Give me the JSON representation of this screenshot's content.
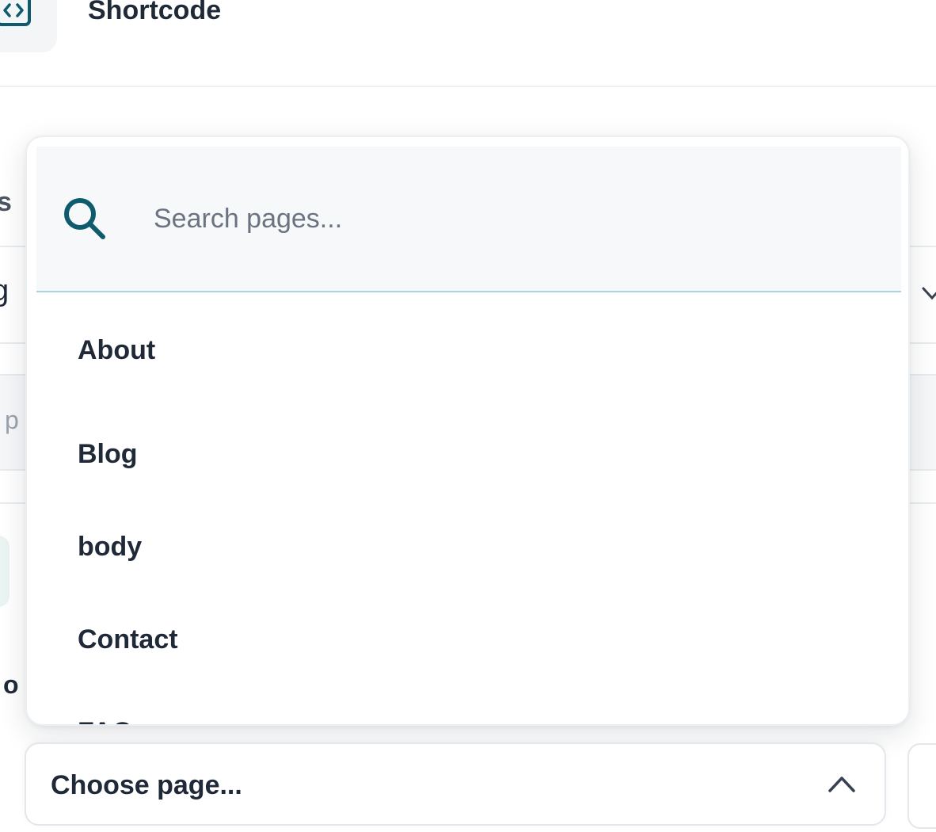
{
  "header": {
    "title": "Shortcode",
    "icon": "code-brackets-icon"
  },
  "background": {
    "partial_text_left": "s",
    "partial_glyph": "g",
    "partial_placeholder": "p",
    "partial_bold_text": "o"
  },
  "dropdown": {
    "search": {
      "placeholder": "Search pages...",
      "value": "",
      "icon": "search-icon"
    },
    "options": [
      "About",
      "Blog",
      "body",
      "Contact",
      "FAQ"
    ]
  },
  "picker": {
    "label": "Choose page...",
    "icon": "chevron-up-icon"
  },
  "colors": {
    "accent": "#0f5b6e",
    "search_underline": "#a9d5e2",
    "text": "#1f2937",
    "placeholder": "#6b7280",
    "panel_bg": "#f7f8fa"
  }
}
